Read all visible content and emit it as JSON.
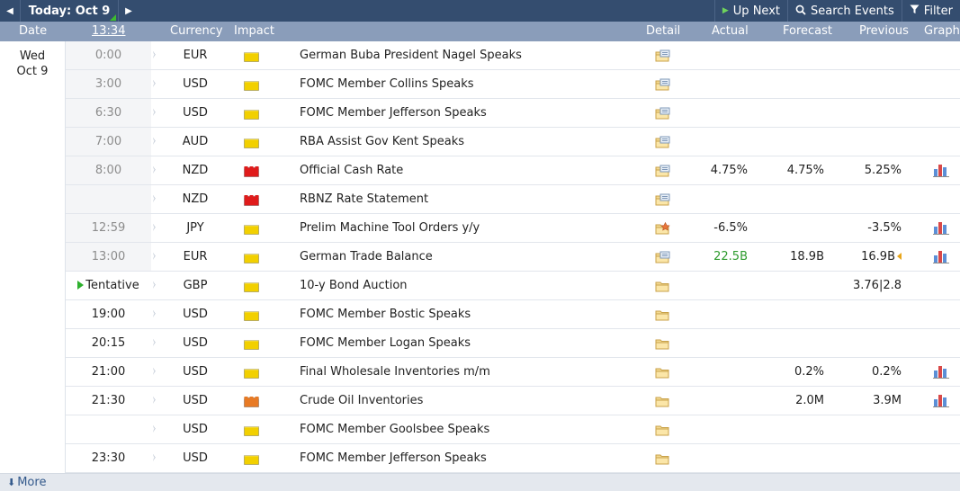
{
  "toolbar": {
    "prev_icon": "left-arrow-icon",
    "today_label": "Today: Oct 9",
    "next_icon": "right-arrow-icon",
    "up_next_label": "Up Next",
    "search_label": "Search Events",
    "filter_label": "Filter"
  },
  "header": {
    "date": "Date",
    "time": "13:34",
    "currency": "Currency",
    "impact": "Impact",
    "detail": "Detail",
    "actual": "Actual",
    "forecast": "Forecast",
    "previous": "Previous",
    "graph": "Graph"
  },
  "date": {
    "weekday": "Wed",
    "day": "Oct 9"
  },
  "colors": {
    "impact_low": "#f2d000",
    "impact_medium": "#e87a24",
    "impact_high": "#e01b1b",
    "better": "#2e9b2e",
    "toolbar": "#344d6f",
    "header": "#8a9dba"
  },
  "events": [
    {
      "time": "0:00",
      "past": true,
      "currency": "EUR",
      "impact": "low",
      "event": "German Buba President Nagel Speaks",
      "detail": "folder-updated",
      "actual": "",
      "forecast": "",
      "previous": "",
      "graph": false
    },
    {
      "time": "3:00",
      "past": true,
      "currency": "USD",
      "impact": "low",
      "event": "FOMC Member Collins Speaks",
      "detail": "folder-updated",
      "actual": "",
      "forecast": "",
      "previous": "",
      "graph": false
    },
    {
      "time": "6:30",
      "past": true,
      "currency": "USD",
      "impact": "low",
      "event": "FOMC Member Jefferson Speaks",
      "detail": "folder-updated",
      "actual": "",
      "forecast": "",
      "previous": "",
      "graph": false
    },
    {
      "time": "7:00",
      "past": true,
      "currency": "AUD",
      "impact": "low",
      "event": "RBA Assist Gov Kent Speaks",
      "detail": "folder-updated",
      "actual": "",
      "forecast": "",
      "previous": "",
      "graph": false
    },
    {
      "time": "8:00",
      "past": true,
      "currency": "NZD",
      "impact": "high",
      "event": "Official Cash Rate",
      "detail": "folder-updated",
      "actual": "4.75%",
      "forecast": "4.75%",
      "previous": "5.25%",
      "graph": true
    },
    {
      "time": "",
      "past": true,
      "currency": "NZD",
      "impact": "high",
      "event": "RBNZ Rate Statement",
      "detail": "folder-updated",
      "actual": "",
      "forecast": "",
      "previous": "",
      "graph": false
    },
    {
      "time": "12:59",
      "past": true,
      "currency": "JPY",
      "impact": "low",
      "event": "Prelim Machine Tool Orders y/y",
      "detail": "folder-star",
      "actual": "-6.5%",
      "forecast": "",
      "previous": "-3.5%",
      "graph": true
    },
    {
      "time": "13:00",
      "past": true,
      "currency": "EUR",
      "impact": "low",
      "event": "German Trade Balance",
      "detail": "folder-updated",
      "actual": "22.5B",
      "actual_better": true,
      "forecast": "18.9B",
      "previous": "16.9B",
      "revised": true,
      "graph": true
    },
    {
      "time": "Tentative",
      "tentative": true,
      "currency": "GBP",
      "impact": "low",
      "event": "10-y Bond Auction",
      "detail": "folder",
      "actual": "",
      "forecast": "",
      "previous": "3.76|2.8",
      "graph": false
    },
    {
      "time": "19:00",
      "currency": "USD",
      "impact": "low",
      "event": "FOMC Member Bostic Speaks",
      "detail": "folder",
      "actual": "",
      "forecast": "",
      "previous": "",
      "graph": false
    },
    {
      "time": "20:15",
      "currency": "USD",
      "impact": "low",
      "event": "FOMC Member Logan Speaks",
      "detail": "folder",
      "actual": "",
      "forecast": "",
      "previous": "",
      "graph": false
    },
    {
      "time": "21:00",
      "currency": "USD",
      "impact": "low",
      "event": "Final Wholesale Inventories m/m",
      "detail": "folder",
      "actual": "",
      "forecast": "0.2%",
      "previous": "0.2%",
      "graph": true
    },
    {
      "time": "21:30",
      "currency": "USD",
      "impact": "medium",
      "event": "Crude Oil Inventories",
      "detail": "folder",
      "actual": "",
      "forecast": "2.0M",
      "previous": "3.9M",
      "graph": true
    },
    {
      "time": "",
      "currency": "USD",
      "impact": "low",
      "event": "FOMC Member Goolsbee Speaks",
      "detail": "folder",
      "actual": "",
      "forecast": "",
      "previous": "",
      "graph": false
    },
    {
      "time": "23:30",
      "currency": "USD",
      "impact": "low",
      "event": "FOMC Member Jefferson Speaks",
      "detail": "folder",
      "actual": "",
      "forecast": "",
      "previous": "",
      "graph": false
    }
  ],
  "footer": {
    "more_label": "More"
  }
}
